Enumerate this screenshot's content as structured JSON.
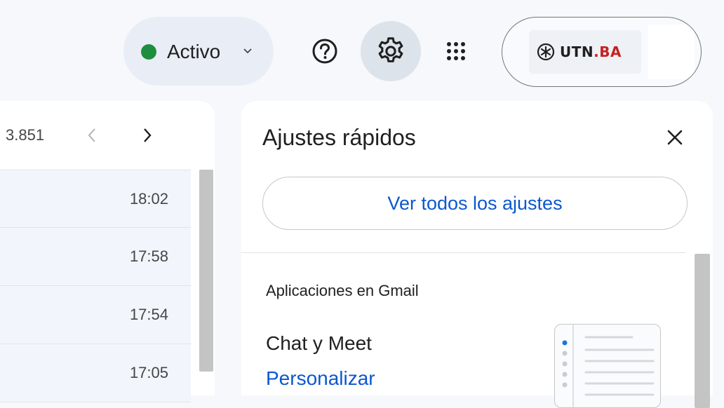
{
  "header": {
    "status": {
      "label": "Activo",
      "dot_color": "#1e8e3e",
      "chevron_icon": "chevron-down-icon"
    },
    "help": {
      "icon": "help-icon"
    },
    "settings": {
      "icon": "gear-icon"
    },
    "apps": {
      "icon": "apps-grid-icon"
    },
    "account": {
      "org_logo_text": "UTN.BA",
      "org_logo_parts": {
        "main": "UTN",
        "suffix": ".BA"
      }
    }
  },
  "mail_list": {
    "page_range": "3.851",
    "prev_icon": "chevron-left-icon",
    "next_icon": "chevron-right-icon",
    "rows": [
      {
        "time": "18:02"
      },
      {
        "time": "17:58"
      },
      {
        "time": "17:54"
      },
      {
        "time": "17:05"
      }
    ]
  },
  "quick_settings": {
    "title": "Ajustes rápidos",
    "close_icon": "close-icon",
    "see_all_label": "Ver todos los ajustes",
    "section_title": "Aplicaciones en Gmail",
    "item_title": "Chat y Meet",
    "item_link": "Personalizar"
  },
  "colors": {
    "accent_blue": "#0b57d0",
    "status_green": "#1e8e3e",
    "brand_red": "#c5221f"
  }
}
